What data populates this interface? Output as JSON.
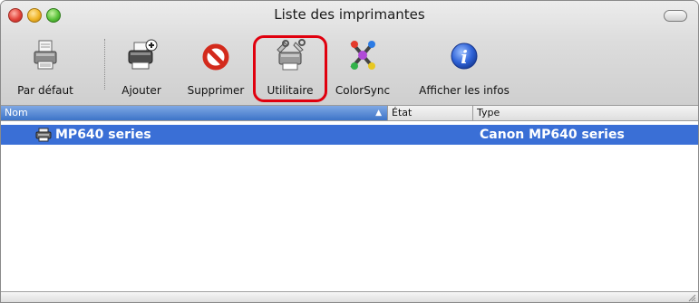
{
  "window": {
    "title": "Liste des imprimantes"
  },
  "toolbar": {
    "default_label": "Par défaut",
    "add_label": "Ajouter",
    "delete_label": "Supprimer",
    "utility_label": "Utilitaire",
    "colorsync_label": "ColorSync",
    "info_label": "Afficher les infos"
  },
  "table": {
    "columns": [
      "Nom",
      "État",
      "Type"
    ],
    "sorted_column": "Nom",
    "rows": [
      {
        "name": "MP640 series",
        "status": "",
        "type": "Canon MP640 series",
        "selected": true
      }
    ]
  },
  "colors": {
    "selection": "#3a6fd6",
    "highlight_ring": "#e0000e"
  }
}
